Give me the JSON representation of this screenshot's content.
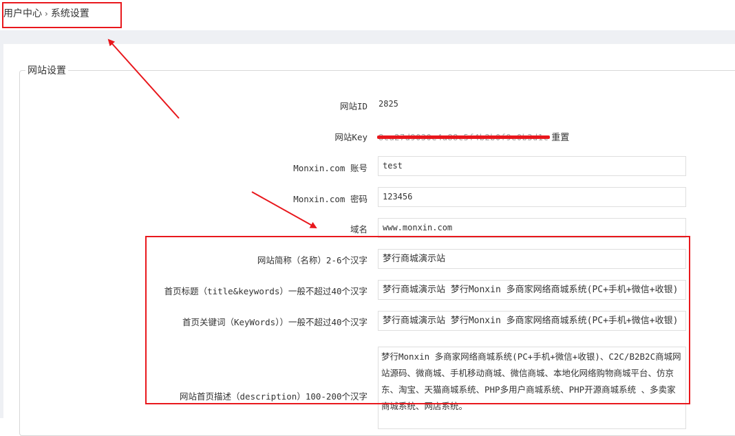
{
  "breadcrumb": {
    "root": "用户中心",
    "separator": "›",
    "current": "系统设置"
  },
  "fieldset": {
    "legend": "网站设置"
  },
  "rows": {
    "site_id": {
      "label": "网站ID",
      "value": "2825"
    },
    "site_key": {
      "label": "网站Key",
      "value_masked": "8ca27d9030e4a88c5f4b2b0f9e0b3d1c",
      "reset": "重置"
    },
    "account": {
      "label": "Monxin.com 账号",
      "value": "test"
    },
    "password": {
      "label": "Monxin.com 密码",
      "value": "123456"
    },
    "domain": {
      "label": "域名",
      "value": "www.monxin.com"
    },
    "short_name": {
      "label": "网站简称（名称）2-6个汉字",
      "value": "梦行商城演示站"
    },
    "home_title": {
      "label": "首页标题（title&keywords）一般不超过40个汉字",
      "value": "梦行商城演示站 梦行Monxin 多商家网络商城系统(PC+手机+微信+收银)"
    },
    "home_keywords": {
      "label": "首页关键词（KeyWords））一般不超过40个汉字",
      "value": "梦行商城演示站 梦行Monxin 多商家网络商城系统(PC+手机+微信+收银)"
    },
    "home_description": {
      "label": "网站首页描述（description）100-200个汉字",
      "value": "梦行Monxin 多商家网络商城系统(PC+手机+微信+收银)、C2C/B2B2C商城网站源码、微商城、手机移动商城、微信商城、本地化网络购物商城平台、仿京东、淘宝、天猫商城系统、PHP多用户商城系统、PHP开源商城系统 、多卖家商城系统、网店系统。"
    }
  },
  "colors": {
    "annotation": "#e8171c",
    "page_gray": "#eef0f4",
    "border": "#dedede"
  }
}
